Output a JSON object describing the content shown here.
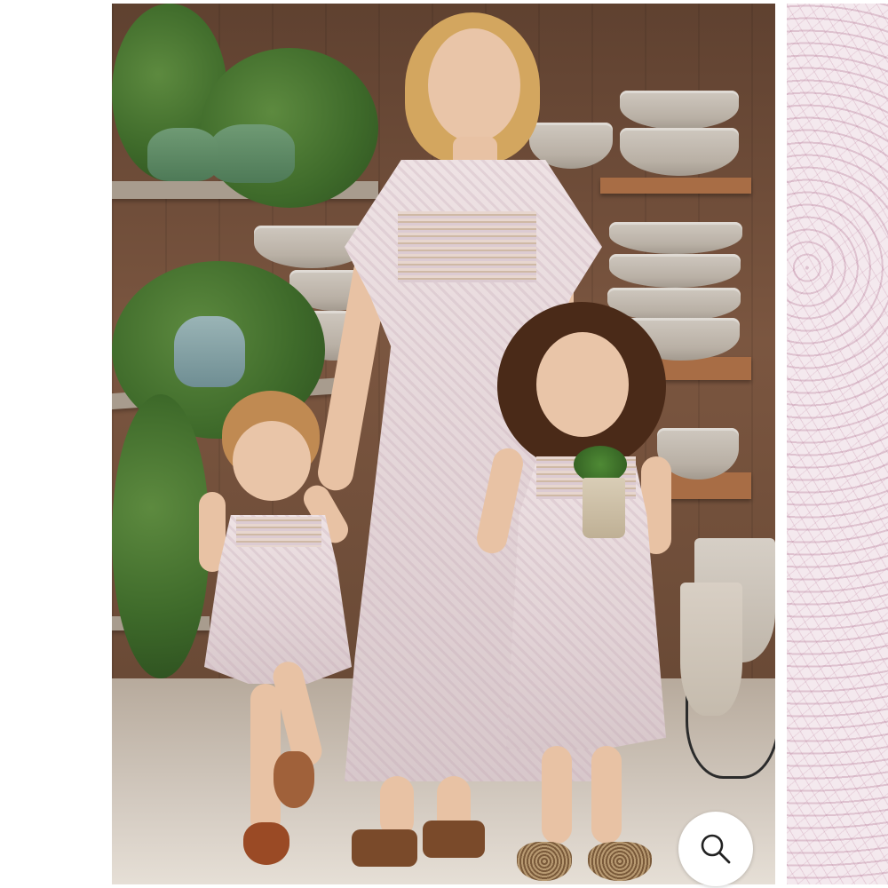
{
  "gallery": {
    "main_image_alt": "",
    "zoom_icon": "magnifier-icon",
    "colors": {
      "background": "#ffffff",
      "zoom_button_bg": "#ffffff",
      "zoom_icon_stroke": "#222222",
      "dress_fabric": "#e6d8db",
      "fabric_print": "#c48aa4"
    }
  }
}
